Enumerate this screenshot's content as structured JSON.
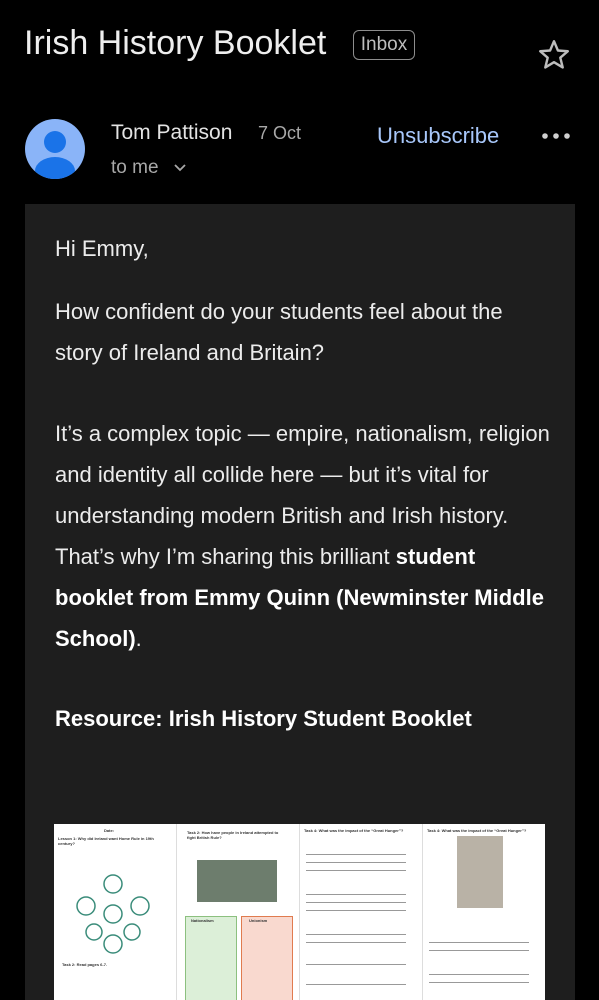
{
  "header": {
    "subject": "Irish History Booklet",
    "badge": "Inbox"
  },
  "sender": {
    "name": "Tom Pattison",
    "date": "7 Oct",
    "to": "to me",
    "unsubscribe": "Unsubscribe"
  },
  "body": {
    "greeting": "Hi Emmy,",
    "para1": "How confident do your students feel about the story of Ireland and Britain?",
    "para2_text": "It’s a complex topic — empire, nationalism, religion and identity all collide here — but it’s vital for understanding modern British and Irish history. That’s why I’m sharing this brilliant ",
    "para2_bold": "student booklet from Emmy Quinn (Newminster Middle School)",
    "para2_end": ".",
    "resource": "Resource: Irish History Student Booklet"
  },
  "preview": {
    "page1_title": "Date:",
    "page1_lesson": "Lesson 1: Why did Ireland want Home Rule in 19th century?",
    "page1_task": "Task 2: Read pages 6-7.",
    "page2_task": "Task 2: How have people in Ireland attempted to fight British Rule?",
    "page2_col1": "Nationalism",
    "page2_col2": "Unionism",
    "page3_title": "Task 4: What was the impact of the “Great Hunger”?",
    "page4_title": "Task 4: What was the impact of the “Great Hunger”?"
  },
  "icons": {
    "star": "star-icon",
    "more": "more-vert-icon",
    "chevron": "chevron-down-icon",
    "avatar": "person-icon"
  },
  "colors": {
    "link": "#a8c7fa",
    "avatar": "#8ab4f8",
    "card": "#1e1e1e"
  }
}
